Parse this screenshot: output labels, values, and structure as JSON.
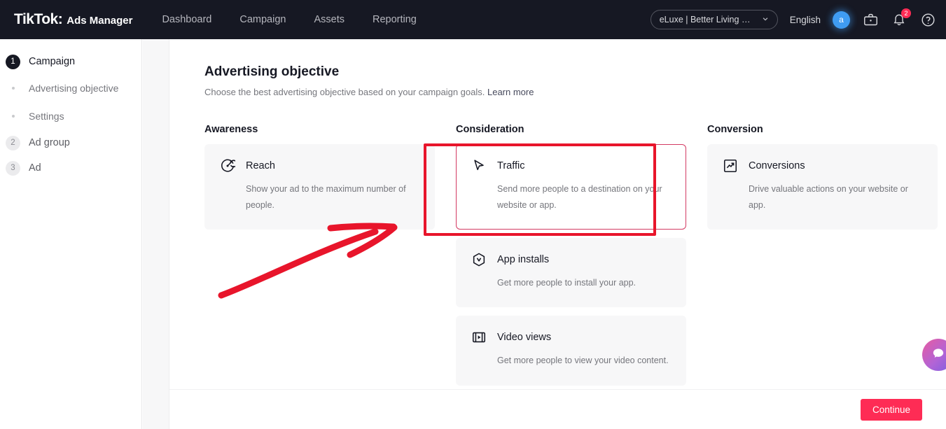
{
  "header": {
    "brand_primary": "TikTok:",
    "brand_secondary": "Ads Manager",
    "nav": [
      {
        "label": "Dashboard"
      },
      {
        "label": "Campaign"
      },
      {
        "label": "Assets"
      },
      {
        "label": "Reporting"
      }
    ],
    "account_selector": "eLuxe | Better Living Sh...",
    "language": "English",
    "avatar_initial": "a",
    "briefcase_icon": "briefcase-icon",
    "notifications_icon": "bell-icon",
    "notifications_count": "2",
    "help_icon": "help-circle-icon"
  },
  "sidebar": {
    "steps": [
      {
        "num": "1",
        "label": "Campaign",
        "active": true
      },
      {
        "num": "2",
        "label": "Ad group",
        "active": false
      },
      {
        "num": "3",
        "label": "Ad",
        "active": false
      }
    ],
    "substeps": [
      {
        "label": "Advertising objective"
      },
      {
        "label": "Settings"
      }
    ]
  },
  "main": {
    "title": "Advertising objective",
    "subtitle": "Choose the best advertising objective based on your campaign goals.",
    "learn_more": "Learn more",
    "columns": [
      {
        "title": "Awareness",
        "cards": [
          {
            "name": "Reach",
            "desc": "Show your ad to the maximum number of people.",
            "icon": "target-icon",
            "selected": false
          }
        ]
      },
      {
        "title": "Consideration",
        "cards": [
          {
            "name": "Traffic",
            "desc": "Send more people to a destination on your website or app.",
            "icon": "cursor-arrow-icon",
            "selected": true
          },
          {
            "name": "App installs",
            "desc": "Get more people to install your app.",
            "icon": "app-hexagon-icon",
            "selected": false
          },
          {
            "name": "Video views",
            "desc": "Get more people to view your video content.",
            "icon": "film-play-icon",
            "selected": false
          }
        ]
      },
      {
        "title": "Conversion",
        "cards": [
          {
            "name": "Conversions",
            "desc": "Drive valuable actions on your website or app.",
            "icon": "trending-up-icon",
            "selected": false
          }
        ]
      }
    ]
  },
  "footer": {
    "continue_label": "Continue"
  },
  "chat": {
    "icon": "chat-bubble-icon"
  },
  "colors": {
    "brand_pink": "#fe2c55",
    "topbar_bg": "#161823",
    "annotation_red": "#e8152b",
    "selected_border": "#d33a63",
    "card_bg": "#f7f7f8",
    "avatar_blue": "#3f9cf2"
  }
}
